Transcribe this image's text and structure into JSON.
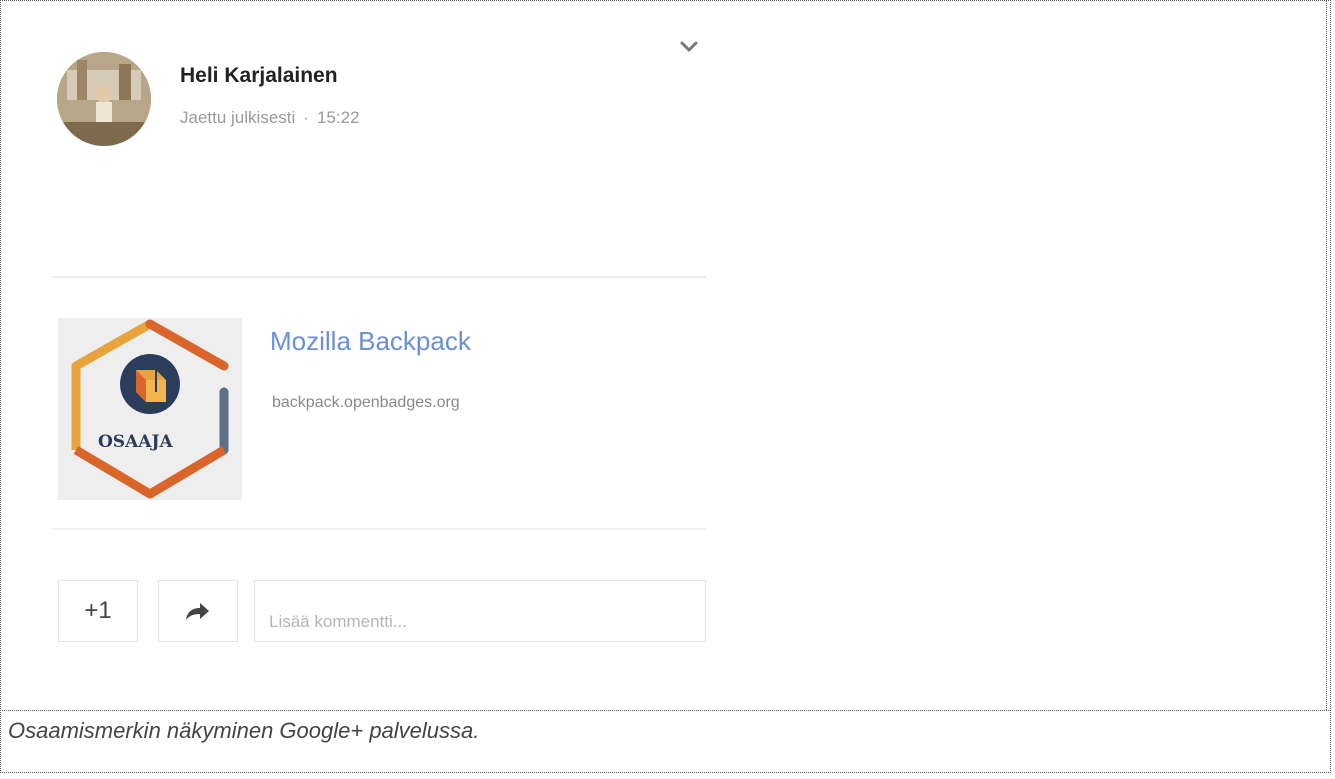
{
  "post": {
    "author_name": "Heli Karjalainen",
    "visibility": "Jaettu julkisesti",
    "separator": "·",
    "time": "15:22",
    "avatar_icon": "user-avatar-photo",
    "menu_icon": "chevron-down-icon"
  },
  "link_preview": {
    "title": "Mozilla Backpack",
    "url": "backpack.openbadges.org",
    "thumbnail": {
      "badge_text": "OSAAJA",
      "colors": {
        "orange": "#e8a43a",
        "dark_orange": "#d9652a",
        "navy": "#2a3e5c",
        "slate": "#5d6f86"
      }
    }
  },
  "actions": {
    "plus_one_label": "+1",
    "share_icon": "share-arrow-icon",
    "comment_placeholder": "Lisää kommentti..."
  },
  "caption": "Osaamismerkin näkyminen Google+ palvelussa."
}
